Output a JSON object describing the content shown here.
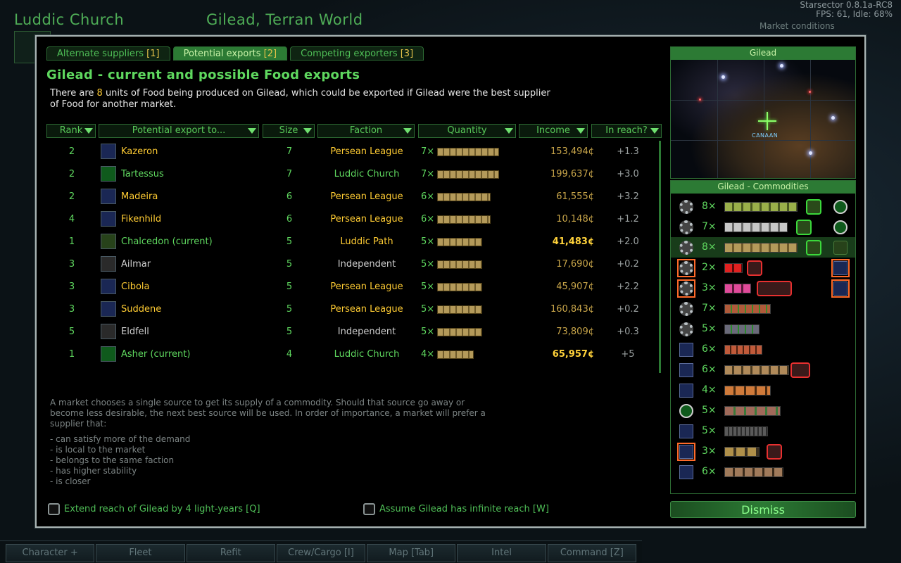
{
  "background": {
    "faction_name": "Luddic Church",
    "world_name": "Gilead, Terran World",
    "version_line1": "Starsector 0.8.1a-RC8",
    "version_line2": "FPS: 61, Idle: 68%",
    "market_conditions": "Market conditions"
  },
  "bottom_bar": {
    "tabs": [
      "Character +",
      "Fleet",
      "Refit",
      "Crew/Cargo [I]",
      "Map [Tab]",
      "Intel",
      "Command [Z]"
    ]
  },
  "dialog": {
    "tabs": [
      {
        "label": "Alternate suppliers ",
        "count": "[1]"
      },
      {
        "label": "Potential exports ",
        "count": "[2]"
      },
      {
        "label": "Competing exporters ",
        "count": "[3]"
      }
    ],
    "title": "Gilead - current and possible Food exports",
    "desc_pre": "There are ",
    "desc_num": "8",
    "desc_post": " units of Food being produced on Gilead, which could be exported if Gilead were the best supplier of Food for another market.",
    "columns": [
      "Rank",
      "Potential export to...",
      "Size",
      "Faction",
      "Quantity",
      "Income",
      "In reach?"
    ],
    "rows": [
      {
        "rank": "2",
        "name": "Kazeron",
        "size": "7",
        "faction": "Persean League",
        "qty": "7×",
        "income": "153,494¢",
        "reach": "+1.3"
      },
      {
        "rank": "2",
        "name": "Tartessus",
        "size": "7",
        "faction": "Luddic Church",
        "qty": "7×",
        "income": "199,637¢",
        "reach": "+3.0"
      },
      {
        "rank": "2",
        "name": "Madeira",
        "size": "6",
        "faction": "Persean League",
        "qty": "6×",
        "income": "61,555¢",
        "reach": "+3.2"
      },
      {
        "rank": "4",
        "name": "Fikenhild",
        "size": "6",
        "faction": "Persean League",
        "qty": "6×",
        "income": "10,148¢",
        "reach": "+1.2"
      },
      {
        "rank": "1",
        "name": "Chalcedon (current)",
        "size": "5",
        "faction": "Luddic Path",
        "qty": "5×",
        "income": "41,483¢",
        "reach": "+2.0"
      },
      {
        "rank": "3",
        "name": "Ailmar",
        "size": "5",
        "faction": "Independent",
        "qty": "5×",
        "income": "17,690¢",
        "reach": "+0.2"
      },
      {
        "rank": "3",
        "name": "Cibola",
        "size": "5",
        "faction": "Persean League",
        "qty": "5×",
        "income": "45,907¢",
        "reach": "+2.2"
      },
      {
        "rank": "3",
        "name": "Suddene",
        "size": "5",
        "faction": "Persean League",
        "qty": "5×",
        "income": "160,843¢",
        "reach": "+0.2"
      },
      {
        "rank": "5",
        "name": "Eldfell",
        "size": "5",
        "faction": "Independent",
        "qty": "5×",
        "income": "73,809¢",
        "reach": "+0.3"
      },
      {
        "rank": "1",
        "name": "Asher (current)",
        "size": "4",
        "faction": "Luddic Church",
        "qty": "4×",
        "income": "65,957¢",
        "reach": "+5"
      }
    ],
    "info_text": "A market chooses a single source to get its supply of a commodity. Should that source go away or become less desirable, the next best source will be used. In order of importance, a market will prefer a supplier that:",
    "info_list": [
      "- can satisfy more of the demand",
      "- is local to the market",
      "- belongs to the same faction",
      "- has higher stability",
      "- is closer"
    ],
    "checkbox_extend": "Extend reach of Gilead by 4 light-years [Q]",
    "checkbox_infinite": "Assume Gilead has infinite reach [W]",
    "map_title": "Gilead",
    "map_label": "CANAAN",
    "commodities_title": "Gilead - Commodities",
    "commodities": [
      {
        "qty": "8×"
      },
      {
        "qty": "7×"
      },
      {
        "qty": "8×"
      },
      {
        "qty": "2×"
      },
      {
        "qty": "3×"
      },
      {
        "qty": "7×"
      },
      {
        "qty": "5×"
      },
      {
        "qty": "6×"
      },
      {
        "qty": "6×"
      },
      {
        "qty": "4×"
      },
      {
        "qty": "5×"
      },
      {
        "qty": "5×"
      },
      {
        "qty": "3×"
      },
      {
        "qty": "6×"
      }
    ],
    "dismiss": "Dismiss"
  }
}
